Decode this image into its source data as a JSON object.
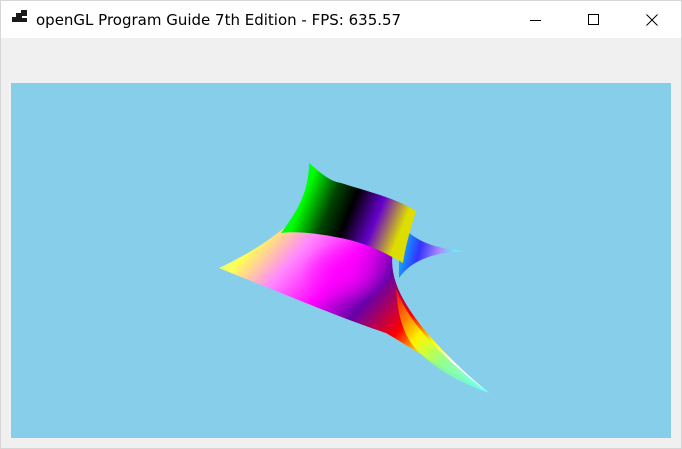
{
  "window": {
    "title": "openGL Program Guide 7th Edition - FPS: 635.57",
    "icon": "app-window-icon"
  },
  "titlebar_buttons": {
    "minimize_icon": "minimize-icon",
    "maximize_icon": "maximize-icon",
    "close_icon": "close-icon"
  },
  "viewport": {
    "background": "#87ceea",
    "content": "rendered-3d-surface"
  },
  "colors": {
    "viewport_bg": "#87ceea",
    "titlebar_bg": "#ffffff",
    "window_bg": "#f0f0f0"
  }
}
